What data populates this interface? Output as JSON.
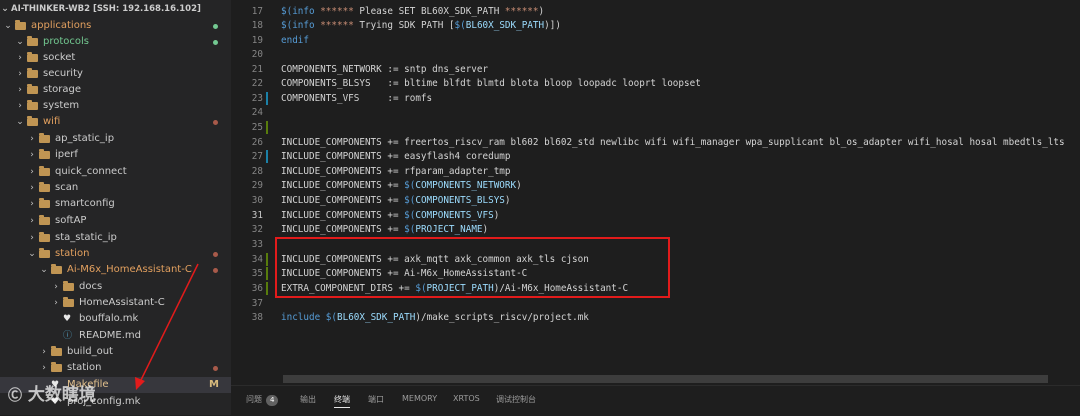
{
  "explorer": {
    "title": "AI-THINKER-WB2 [SSH: 192.168.16.102]",
    "items": [
      {
        "label": "applications",
        "chev": "⌄",
        "folder": true,
        "color": "#e2a05f",
        "dot": "#73c991"
      },
      {
        "label": "protocols",
        "chev": "⌄",
        "folder": true,
        "color": "#73c991",
        "dot": "#73c991"
      },
      {
        "label": "socket",
        "chev": "›",
        "folder": true,
        "color": "#cccccc"
      },
      {
        "label": "security",
        "chev": "›",
        "folder": true,
        "color": "#cccccc"
      },
      {
        "label": "storage",
        "chev": "›",
        "folder": true,
        "color": "#cccccc"
      },
      {
        "label": "system",
        "chev": "›",
        "folder": true,
        "color": "#cccccc"
      },
      {
        "label": "wifi",
        "chev": "⌄",
        "folder": true,
        "color": "#e2a05f",
        "dot": "#a85a4a"
      },
      {
        "label": "ap_static_ip",
        "chev": "›",
        "folder": true,
        "color": "#cccccc"
      },
      {
        "label": "iperf",
        "chev": "›",
        "folder": true,
        "color": "#cccccc"
      },
      {
        "label": "quick_connect",
        "chev": "›",
        "folder": true,
        "color": "#cccccc"
      },
      {
        "label": "scan",
        "chev": "›",
        "folder": true,
        "color": "#cccccc"
      },
      {
        "label": "smartconfig",
        "chev": "›",
        "folder": true,
        "color": "#cccccc"
      },
      {
        "label": "softAP",
        "chev": "›",
        "folder": true,
        "color": "#cccccc"
      },
      {
        "label": "sta_static_ip",
        "chev": "›",
        "folder": true,
        "color": "#cccccc"
      },
      {
        "label": "station",
        "chev": "⌄",
        "folder": true,
        "color": "#e2a05f",
        "dot": "#a85a4a"
      },
      {
        "label": "Ai-M6x_HomeAssistant-C",
        "chev": "⌄",
        "folder": true,
        "color": "#e2a05f",
        "dot": "#a85a4a"
      },
      {
        "label": "docs",
        "chev": "›",
        "folder": true,
        "color": "#cccccc"
      },
      {
        "label": "HomeAssistant-C",
        "chev": "›",
        "folder": true,
        "color": "#cccccc"
      },
      {
        "label": "bouffalo.mk",
        "chev": "",
        "folder": false,
        "icon": "♥",
        "iconColor": "#e8e8e8",
        "color": "#cccccc"
      },
      {
        "label": "README.md",
        "chev": "",
        "folder": false,
        "icon": "ⓘ",
        "iconColor": "#519aba",
        "color": "#cccccc"
      },
      {
        "label": "build_out",
        "chev": "›",
        "folder": true,
        "color": "#cccccc"
      },
      {
        "label": "station",
        "chev": "›",
        "folder": true,
        "color": "#cccccc",
        "dot": "#a85a4a"
      },
      {
        "label": "Makefile",
        "chev": "",
        "folder": false,
        "icon": "♥",
        "iconColor": "#e8e8e8",
        "color": "#e2c08d",
        "badge": "M",
        "active": true
      },
      {
        "label": "proj_config.mk",
        "chev": "",
        "folder": false,
        "icon": "♥",
        "iconColor": "#e8e8e8",
        "color": "#cccccc"
      }
    ]
  },
  "editor": {
    "lines": [
      {
        "n": "17",
        "text": "$(info ****** Please SET BL60X_SDK_PATH ******)",
        "mark": ""
      },
      {
        "n": "18",
        "text": "$(info ****** Trying SDK PATH [$(BL60X_SDK_PATH)])",
        "mark": ""
      },
      {
        "n": "19",
        "text": "endif",
        "mark": ""
      },
      {
        "n": "20",
        "text": "",
        "mark": ""
      },
      {
        "n": "21",
        "text": "COMPONENTS_NETWORK := sntp dns_server",
        "mark": ""
      },
      {
        "n": "22",
        "text": "COMPONENTS_BLSYS   := bltime blfdt blmtd blota bloop loopadc looprt loopset",
        "mark": ""
      },
      {
        "n": "23",
        "text": "COMPONENTS_VFS     := romfs",
        "mark": "blue"
      },
      {
        "n": "24",
        "text": "",
        "mark": ""
      },
      {
        "n": "25",
        "text": "",
        "mark": "green"
      },
      {
        "n": "26",
        "text": "INCLUDE_COMPONENTS += freertos_riscv_ram bl602 bl602_std newlibc wifi wifi_manager wpa_supplicant bl_os_adapter wifi_hosal hosal mbedtls_lts",
        "mark": ""
      },
      {
        "n": "27",
        "text": "INCLUDE_COMPONENTS += easyflash4 coredump",
        "mark": "blue"
      },
      {
        "n": "28",
        "text": "INCLUDE_COMPONENTS += rfparam_adapter_tmp",
        "mark": ""
      },
      {
        "n": "29",
        "text": "INCLUDE_COMPONENTS += $(COMPONENTS_NETWORK)",
        "mark": ""
      },
      {
        "n": "30",
        "text": "INCLUDE_COMPONENTS += $(COMPONENTS_BLSYS)",
        "mark": ""
      },
      {
        "n": "31",
        "text": "INCLUDE_COMPONENTS += $(COMPONENTS_VFS)",
        "mark": ""
      },
      {
        "n": "32",
        "text": "INCLUDE_COMPONENTS += $(PROJECT_NAME)",
        "mark": ""
      },
      {
        "n": "33",
        "text": "",
        "mark": ""
      },
      {
        "n": "34",
        "text": "INCLUDE_COMPONENTS += axk_mqtt axk_common axk_tls cjson",
        "mark": "green"
      },
      {
        "n": "35",
        "text": "INCLUDE_COMPONENTS += Ai-M6x_HomeAssistant-C",
        "mark": "green"
      },
      {
        "n": "36",
        "text": "EXTRA_COMPONENT_DIRS += $(PROJECT_PATH)/Ai-M6x_HomeAssistant-C",
        "mark": "green"
      },
      {
        "n": "37",
        "text": "",
        "mark": ""
      },
      {
        "n": "38",
        "text": "include $(BL60X_SDK_PATH)/make_scripts_riscv/project.mk",
        "mark": ""
      }
    ],
    "current_line": "31"
  },
  "panel": {
    "tabs": [
      {
        "label": "问题",
        "count": "4",
        "active": false
      },
      {
        "label": "输出",
        "active": false
      },
      {
        "label": "终端",
        "active": true
      },
      {
        "label": "端口",
        "active": false
      },
      {
        "label": "MEMORY",
        "active": false
      },
      {
        "label": "XRTOS",
        "active": false
      },
      {
        "label": "调试控制台",
        "active": false
      }
    ]
  },
  "watermark": {
    "text": "大数瞎境"
  },
  "colors": {
    "accent_box": "#e21b1b",
    "git_added": "#587c0c",
    "git_modified": "#1b81a8"
  }
}
